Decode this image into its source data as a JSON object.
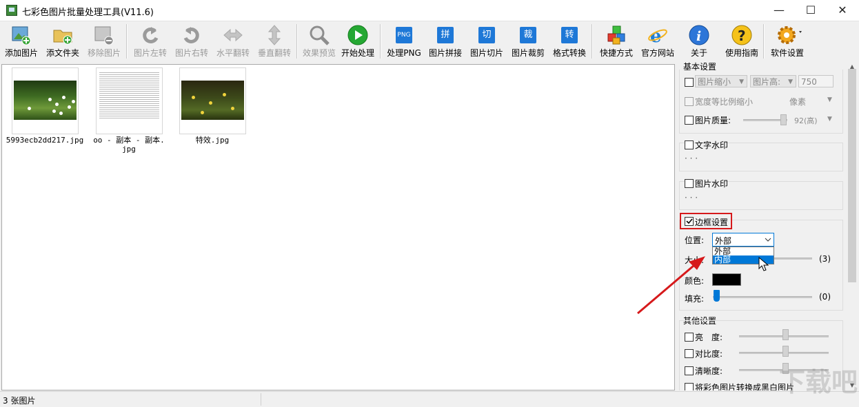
{
  "window": {
    "title": "七彩色图片批量处理工具(V11.6)",
    "min": "—",
    "max": "☐",
    "close": "✕"
  },
  "toolbar": {
    "items": [
      {
        "label": "添加图片",
        "enabled": true,
        "icon": "add-image-icon"
      },
      {
        "label": "添文件夹",
        "enabled": true,
        "icon": "add-folder-icon"
      },
      {
        "label": "移除图片",
        "enabled": false,
        "icon": "remove-image-icon"
      },
      {
        "label": "图片左转",
        "enabled": false,
        "icon": "rotate-left-icon"
      },
      {
        "label": "图片右转",
        "enabled": false,
        "icon": "rotate-right-icon"
      },
      {
        "label": "水平翻转",
        "enabled": false,
        "icon": "flip-horizontal-icon"
      },
      {
        "label": "垂直翻转",
        "enabled": false,
        "icon": "flip-vertical-icon"
      },
      {
        "label": "效果预览",
        "enabled": false,
        "icon": "magnifier-icon"
      },
      {
        "label": "开始处理",
        "enabled": true,
        "icon": "play-icon"
      },
      {
        "label": "处理PNG",
        "enabled": true,
        "icon": "png-icon",
        "glyph": "PNG"
      },
      {
        "label": "图片拼接",
        "enabled": true,
        "icon": "stitch-icon",
        "glyph": "拼"
      },
      {
        "label": "图片切片",
        "enabled": true,
        "icon": "slice-icon",
        "glyph": "切"
      },
      {
        "label": "图片裁剪",
        "enabled": true,
        "icon": "crop-icon",
        "glyph": "裁"
      },
      {
        "label": "格式转换",
        "enabled": true,
        "icon": "convert-icon",
        "glyph": "转"
      },
      {
        "label": "快捷方式",
        "enabled": true,
        "icon": "shortcut-icon"
      },
      {
        "label": "官方网站",
        "enabled": true,
        "icon": "website-icon"
      },
      {
        "label": "关于",
        "enabled": true,
        "icon": "about-icon",
        "glyph": "i"
      },
      {
        "label": "使用指南",
        "enabled": true,
        "icon": "help-icon",
        "glyph": "?"
      },
      {
        "label": "软件设置",
        "enabled": true,
        "icon": "settings-gear-icon"
      }
    ]
  },
  "images": [
    {
      "name": "5993ecb2dd217.jpg",
      "kind": "grass"
    },
    {
      "name": "oo - 副本 - 副本.\njpg",
      "kind": "text"
    },
    {
      "name": "特效.jpg",
      "kind": "dark"
    }
  ],
  "panel": {
    "basic": {
      "title": "基本设置",
      "resize_mode": "图片缩小",
      "height_mode": "图片高:",
      "height_value": "750",
      "keep_ratio": "宽度等比例缩小",
      "unit": "像素",
      "quality_label": "图片质量:",
      "quality_value": "92(高)"
    },
    "text_watermark": {
      "label": "文字水印",
      "dots": "· · ·"
    },
    "image_watermark": {
      "label": "图片水印",
      "dots": "· · ·"
    },
    "border": {
      "label": "边框设置",
      "checked": true,
      "position_label": "位置:",
      "position_value": "外部",
      "options": [
        "外部",
        "内部"
      ],
      "highlighted": "内部",
      "size_label": "大小:",
      "size_value": "(3)",
      "color_label": "颜色:",
      "color": "#000000",
      "fill_label": "填充:",
      "fill_value": "(0)"
    },
    "other": {
      "title": "其他设置",
      "brightness": "亮　度:",
      "contrast": "对比度:",
      "sharpness": "清晰度:",
      "grayscale": "将彩色图片转换成黑白图片"
    }
  },
  "status": {
    "count": "3 张图片"
  },
  "colors": {
    "highlight_red": "#d6191b",
    "selected_blue": "#0078d7"
  },
  "watermark": "下载吧"
}
